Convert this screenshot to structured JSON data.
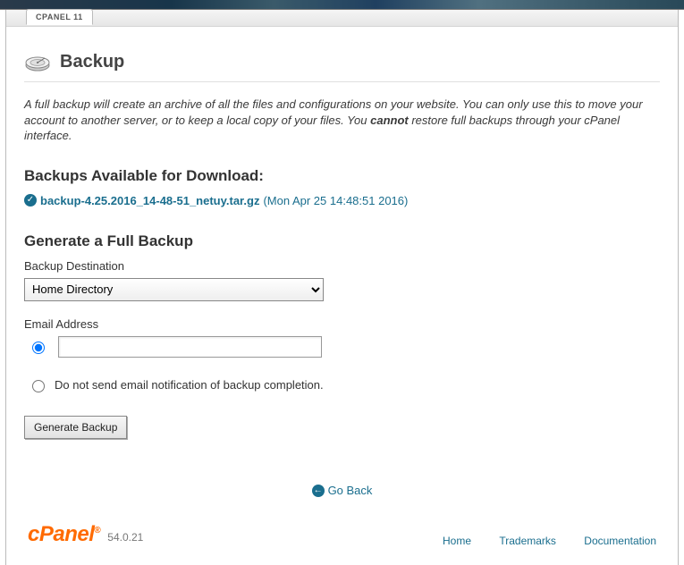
{
  "window": {
    "tab_label": "CPANEL 11"
  },
  "page": {
    "title": "Backup",
    "intro_prefix": "A full backup will create an archive of all the files and configurations on your website. You can only use this to move your account to another server, or to keep a local copy of your files. You ",
    "intro_strong": "cannot",
    "intro_suffix": " restore full backups through your cPanel interface."
  },
  "downloads": {
    "heading": "Backups Available for Download:",
    "items": [
      {
        "filename": "backup-4.25.2016_14-48-51_netuy.tar.gz",
        "meta": "(Mon Apr 25 14:48:51 2016)"
      }
    ]
  },
  "generate": {
    "heading": "Generate a Full Backup",
    "dest_label": "Backup Destination",
    "dest_selected": "Home Directory",
    "email_label": "Email Address",
    "email_value": "",
    "no_email_label": "Do not send email notification of backup completion.",
    "button_label": "Generate Backup"
  },
  "nav": {
    "go_back": "Go Back"
  },
  "footer": {
    "brand": "cPanel",
    "version": "54.0.21",
    "links": {
      "home": "Home",
      "trademarks": "Trademarks",
      "documentation": "Documentation"
    }
  }
}
